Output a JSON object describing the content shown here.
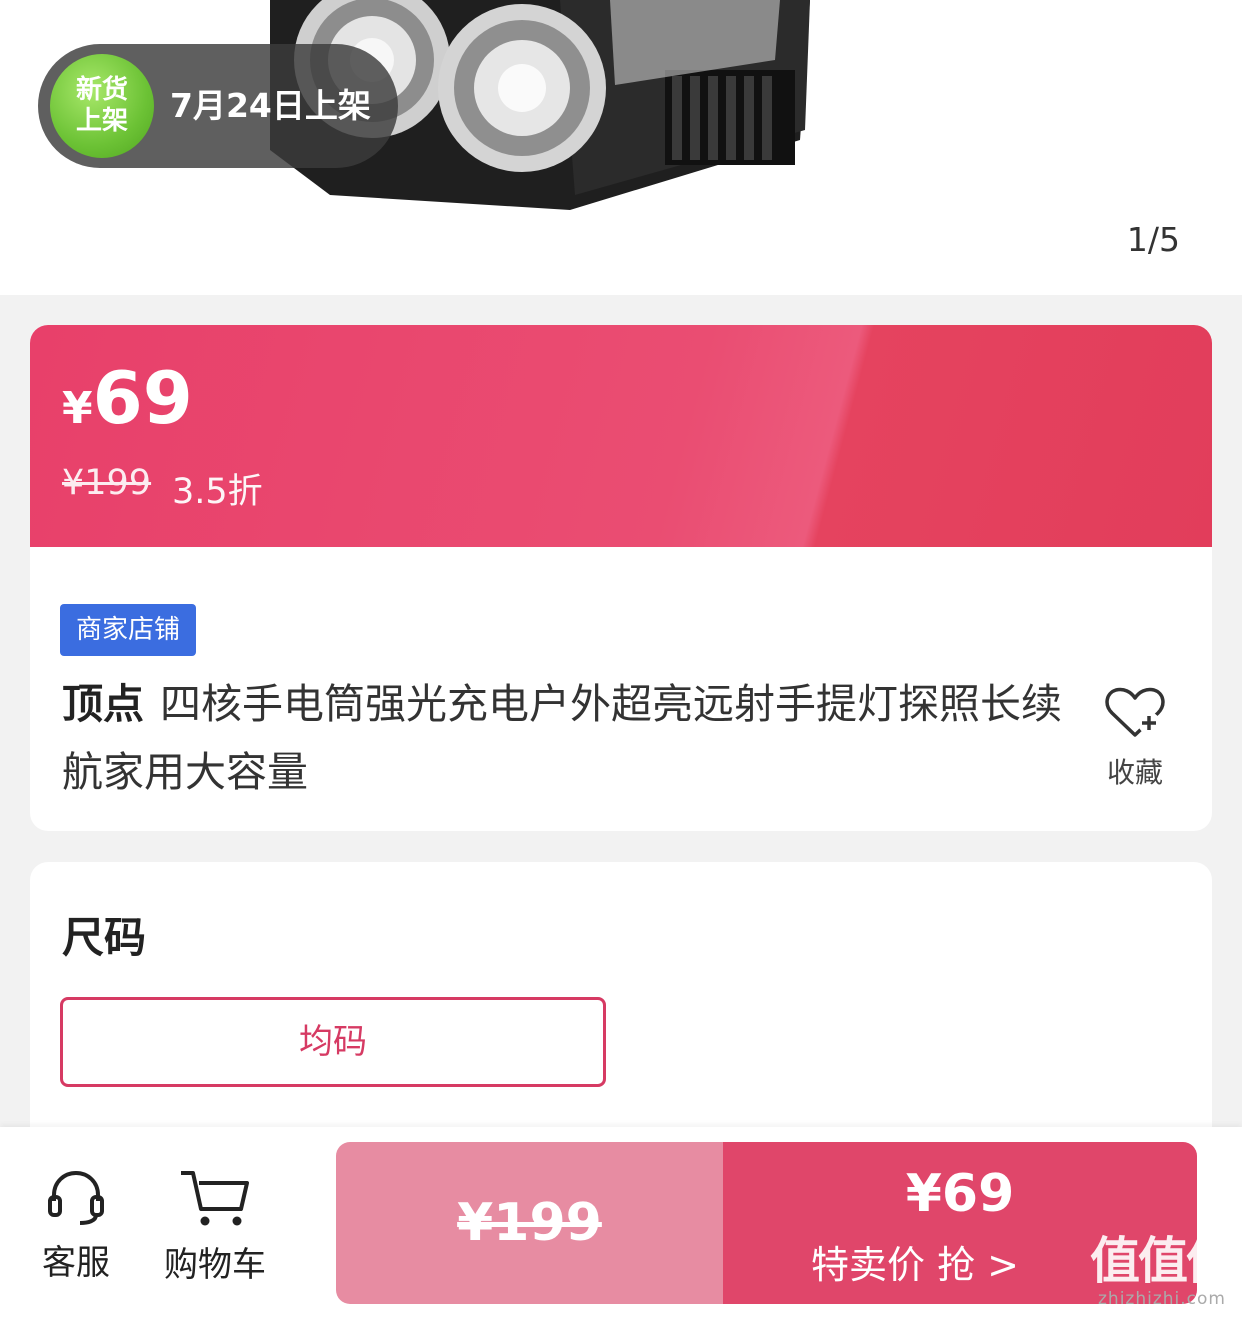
{
  "gallery": {
    "new_badge_text": "新货上架",
    "release_date_text": "7月24日上架",
    "counter": "1/5"
  },
  "price": {
    "current": "69",
    "currency": "¥",
    "original": "¥199",
    "discount": "3.5折"
  },
  "product": {
    "shop_tag": "商家店铺",
    "brand": "顶点",
    "title": "四核手电筒强光充电户外超亮远射手提灯探照长续航家用大容量",
    "favorite_label": "收藏"
  },
  "size": {
    "title": "尺码",
    "option": "均码"
  },
  "bottom_bar": {
    "service_label": "客服",
    "cart_label": "购物车",
    "original_price": "¥199",
    "sale_price": "¥69",
    "sale_label": "特卖价 抢 >"
  },
  "watermark": {
    "main": "值值值",
    "sub": "zhizhizhi.com"
  },
  "colors": {
    "accent": "#e0466a",
    "shop_tag": "#3b6de0",
    "new_badge": "#6cc235"
  }
}
